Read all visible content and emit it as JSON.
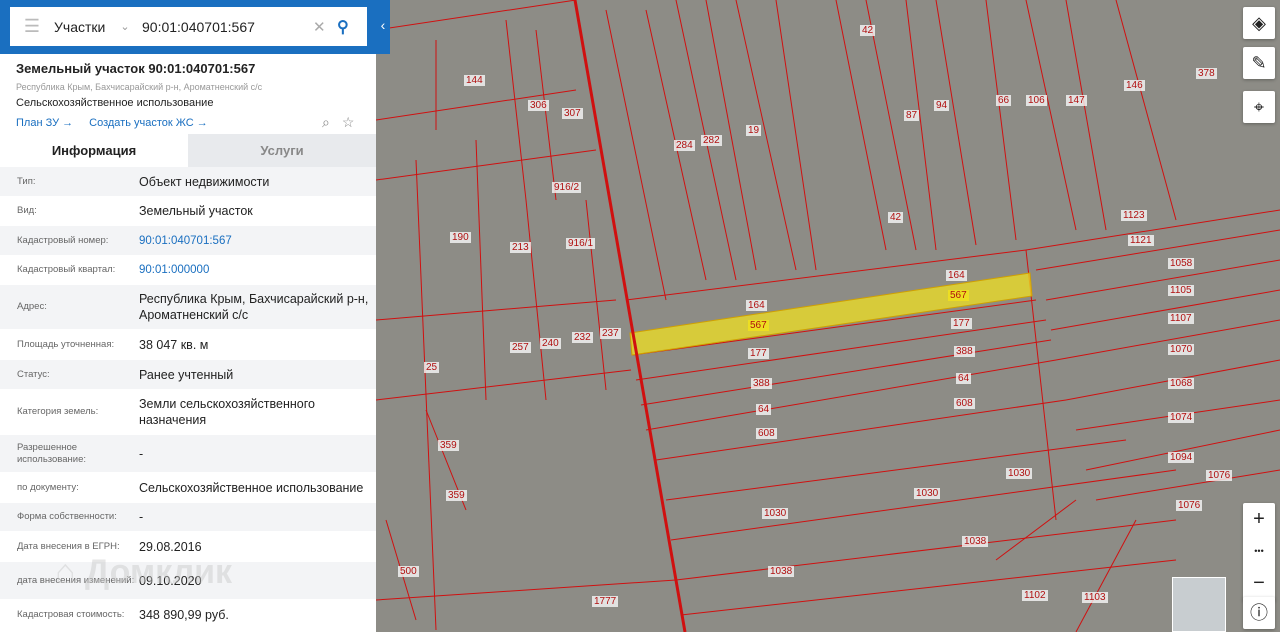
{
  "search": {
    "mode": "Участки",
    "value": "90:01:040701:567"
  },
  "header": {
    "title": "Земельный участок 90:01:040701:567",
    "address": "Республика Крым, Бахчисарайский р-н, Ароматненский с/с",
    "use": "Сельскохозяйственное использование",
    "link_plan": "План ЗУ →",
    "link_create": "Создать участок ЖС →"
  },
  "tabs": {
    "info": "Информация",
    "services": "Услуги"
  },
  "rows": [
    {
      "k": "Тип:",
      "v": "Объект недвижимости"
    },
    {
      "k": "Вид:",
      "v": "Земельный участок"
    },
    {
      "k": "Кадастровый номер:",
      "v": "90:01:040701:567"
    },
    {
      "k": "Кадастровый квартал:",
      "v": "90:01:000000"
    },
    {
      "k": "Адрес:",
      "v": "Республика Крым, Бахчисарайский р-н, Ароматненский с/с"
    },
    {
      "k": "Площадь уточненная:",
      "v": "38 047 кв. м"
    },
    {
      "k": "Статус:",
      "v": "Ранее учтенный"
    },
    {
      "k": "Категория земель:",
      "v": "Земли сельскохозяйственного назначения"
    },
    {
      "k": "Разрешенное использование:",
      "v": "-"
    },
    {
      "k": "по документу:",
      "v": "Сельскохозяйственное использование"
    },
    {
      "k": "Форма собственности:",
      "v": "-"
    },
    {
      "k": "Дата внесения в ЕГРН:",
      "v": "29.08.2016"
    },
    {
      "k": "дата внесения изменений:",
      "v": "09.10.2020"
    },
    {
      "k": "Кадастровая стоимость:",
      "v": "348 890,99 руб."
    }
  ],
  "watermark": "Домклик",
  "map": {
    "parcel_labels": [
      "144",
      "306",
      "307",
      "284",
      "282",
      "19",
      "42",
      "87",
      "94",
      "66",
      "106",
      "147",
      "146",
      "378",
      "916/2",
      "190",
      "213",
      "916/1",
      "42",
      "164",
      "567",
      "567",
      "164",
      "177",
      "177",
      "388",
      "388",
      "64",
      "64",
      "608",
      "608",
      "1123",
      "1121",
      "1058",
      "1105",
      "1107",
      "1070",
      "1068",
      "1074",
      "1094",
      "1076",
      "1030",
      "1030",
      "1030",
      "1076",
      "1038",
      "1038",
      "257",
      "240",
      "232",
      "237",
      "25",
      "359",
      "359",
      "500",
      "1777",
      "1102",
      "1103"
    ],
    "controls": {
      "zoom_in": "+",
      "more": "•••",
      "zoom_out": "−"
    }
  },
  "colors": {
    "accent": "#1a6fc0",
    "boundary": "#d01010",
    "highlight": "#f0e020"
  }
}
